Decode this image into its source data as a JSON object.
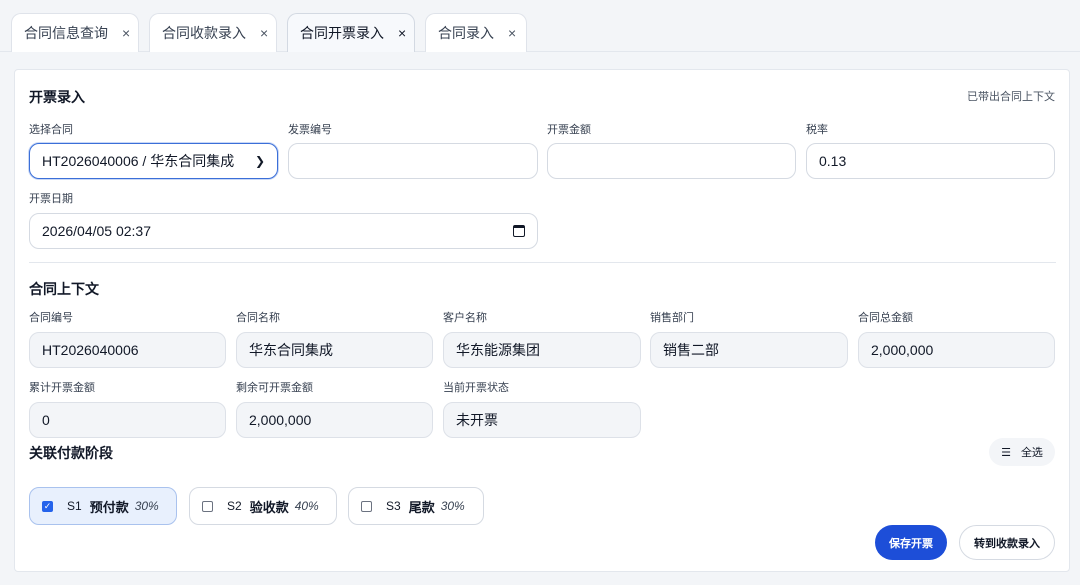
{
  "tabs": [
    {
      "label": "合同信息查询",
      "close": "×"
    },
    {
      "label": "合同收款录入",
      "close": "×"
    },
    {
      "label": "合同开票录入",
      "close": "×"
    },
    {
      "label": "合同录入",
      "close": "×"
    }
  ],
  "active_tab": "合同开票录入",
  "invoice": {
    "title": "开票录入",
    "hint": "已带出合同上下文",
    "contract_label": "选择合同",
    "contract_value": "HT2026040006 / 华东合同集成",
    "invoice_no_label": "发票编号",
    "invoice_no_value": "",
    "amount_label": "开票金额",
    "amount_value": "",
    "tax_label": "税率",
    "tax_value": "0.13",
    "date_label": "开票日期",
    "date_value": "2026/04/05 02:37"
  },
  "context": {
    "title": "合同上下文",
    "contract_no_label": "合同编号",
    "contract_no": "HT2026040006",
    "contract_name_label": "合同名称",
    "contract_name": "华东合同集成",
    "customer_label": "客户名称",
    "customer": "华东能源集团",
    "dept_label": "销售部门",
    "dept": "销售二部",
    "total_label": "合同总金额",
    "total": "2,000,000",
    "invoiced_label": "累计开票金额",
    "invoiced": "0",
    "remaining_label": "剩余可开票金额",
    "remaining": "2,000,000",
    "status_label": "当前开票状态",
    "status": "未开票"
  },
  "stages": {
    "title": "关联付款阶段",
    "select_all": "全选",
    "items": [
      {
        "code": "S1",
        "name": "预付款",
        "pct": "30%",
        "checked": true
      },
      {
        "code": "S2",
        "name": "验收款",
        "pct": "40%",
        "checked": false
      },
      {
        "code": "S3",
        "name": "尾款",
        "pct": "30%",
        "checked": false
      }
    ]
  },
  "actions": {
    "save": "保存开票",
    "to_receipt": "转到收款录入"
  },
  "colors": {
    "primary": "#1d4ed8",
    "checked_bg": "#e8f0fd",
    "readonly_bg": "#f3f5f8"
  }
}
